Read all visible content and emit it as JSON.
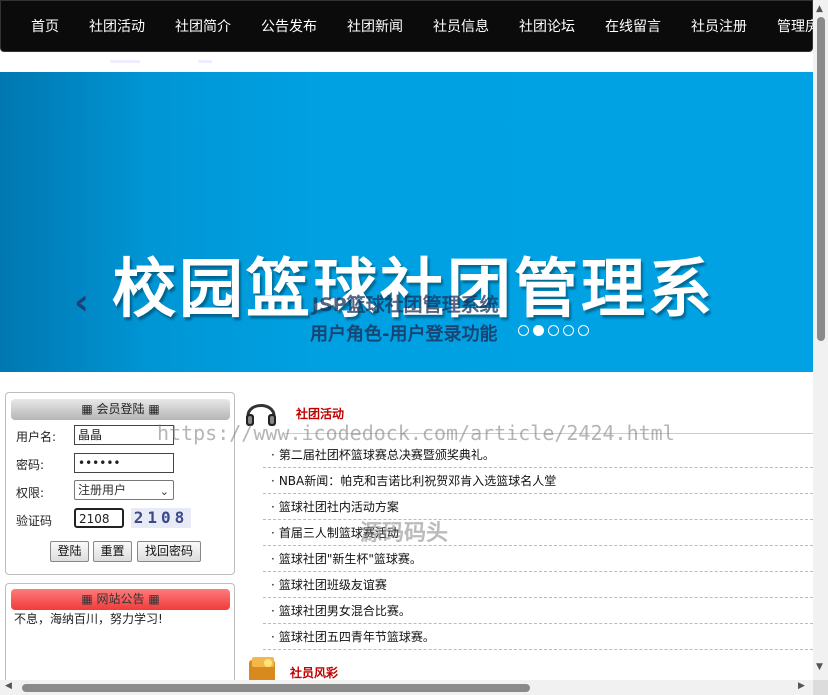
{
  "nav": {
    "items": [
      "首页",
      "社团活动",
      "社团简介",
      "公告发布",
      "社团新闻",
      "社员信息",
      "社团论坛",
      "在线留言",
      "社员注册",
      "管理房"
    ]
  },
  "banner": {
    "big_title": "校园篮球社团管理系",
    "overlay_title": "JSP篮球社团管理系统",
    "subtitle": "用户角色-用户登录功能",
    "prev_arrow": "‹",
    "slide_count": 5,
    "active_slide": 2
  },
  "login": {
    "header": "会员登陆",
    "username_label": "用户名:",
    "username_value": "晶晶",
    "password_label": "密码:",
    "password_value": "••••••",
    "role_label": "权限:",
    "role_value": "注册用户",
    "captcha_label": "验证码",
    "captcha_input": "2108",
    "captcha_image_text": "2108",
    "login_button": "登陆",
    "reset_button": "重置",
    "recover_button": "找回密码"
  },
  "notice": {
    "header": "网站公告",
    "text": "不息，海纳百川，努力学习!"
  },
  "activities": {
    "title": "社团活动",
    "items": [
      "第二届社团杯篮球赛总决赛暨颁奖典礼。",
      "NBA新闻：帕克和吉诺比利祝贺邓肯入选篮球名人堂",
      "篮球社团社内活动方案",
      "首届三人制篮球赛活动",
      "篮球社团\"新生杯\"篮球赛。",
      "篮球社团班级友谊赛",
      "篮球社团男女混合比赛。",
      "篮球社团五四青年节篮球赛。"
    ]
  },
  "members": {
    "title": "社员风彩"
  },
  "watermarks": {
    "url": "https://www.icodedock.com/article/2424.html",
    "brand": "源码码头"
  },
  "colors": {
    "nav_bg": "#0b0b0b",
    "banner_blue": "#00a2e4",
    "section_title": "#c00000",
    "notice_header": "#f03c3c"
  }
}
